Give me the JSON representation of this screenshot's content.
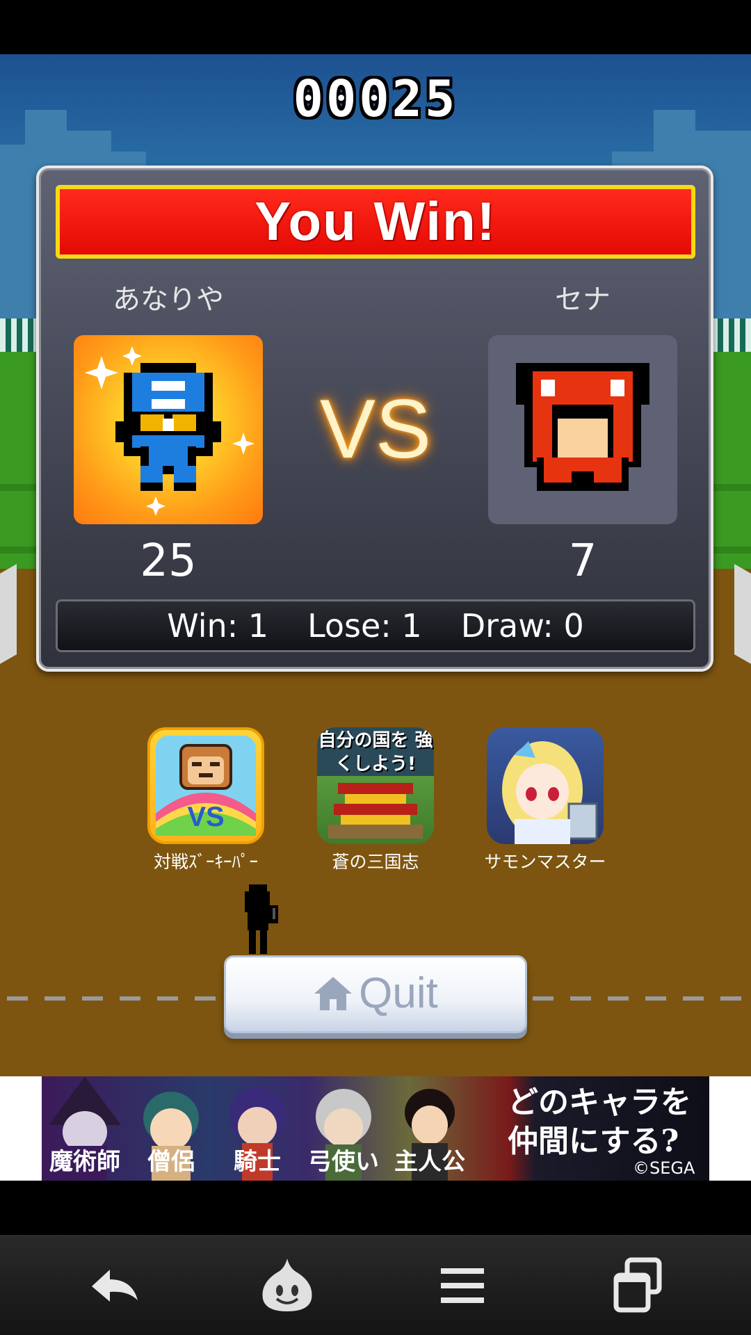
{
  "score_counter": "00025",
  "result": {
    "banner": "You Win!",
    "vs_label": "VS",
    "player1": {
      "name": "あなりや",
      "score": "25"
    },
    "player2": {
      "name": "セナ",
      "score": "7"
    },
    "record": {
      "win": "Win: 1",
      "lose": "Lose: 1",
      "draw": "Draw: 0"
    }
  },
  "promos": [
    {
      "label": "対戦ｽﾞｰｷｰﾊﾟｰ",
      "icon": "zookeeper-vs-icon"
    },
    {
      "label": "蒼の三国志",
      "icon": "sangokushi-icon",
      "icon_text": "自分の国を 強くしよう!"
    },
    {
      "label": "サモンマスター",
      "icon": "summon-master-icon"
    }
  ],
  "quit": {
    "label": "Quit",
    "icon": "home-icon"
  },
  "ad": {
    "characters": [
      "魔術師",
      "僧侶",
      "騎士",
      "弓使い",
      "主人公"
    ],
    "headline_line1": "どのキャラを",
    "headline_line2": "仲間にする?",
    "copyright": "©SEGA"
  },
  "navbar": {
    "icons": [
      "back-icon",
      "slime-icon",
      "menu-icon",
      "recent-apps-icon"
    ]
  },
  "colors": {
    "banner_red": "#e40a04",
    "banner_border": "#f7d816",
    "track_brown": "#7d5510",
    "vs_glow": "#ff8a00"
  }
}
